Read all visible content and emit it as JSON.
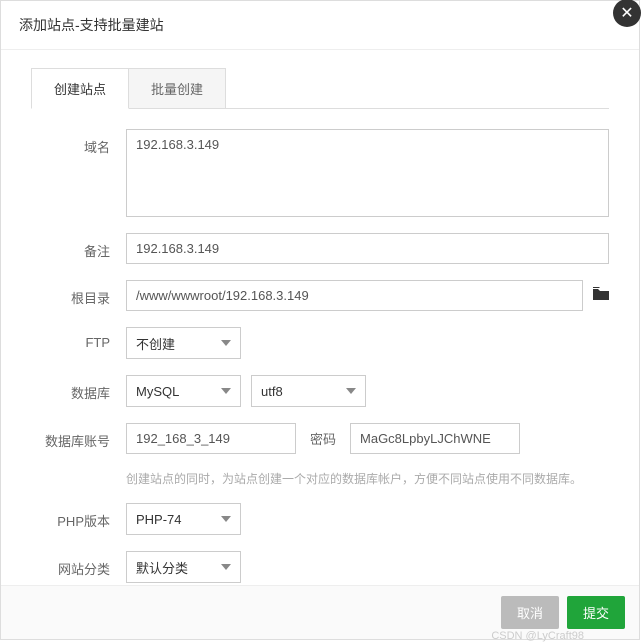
{
  "header": {
    "title": "添加站点-支持批量建站"
  },
  "tabs": {
    "create": "创建站点",
    "batch": "批量创建"
  },
  "labels": {
    "domain": "域名",
    "remark": "备注",
    "root": "根目录",
    "ftp": "FTP",
    "database": "数据库",
    "db_account": "数据库账号",
    "password": "密码",
    "php_version": "PHP版本",
    "category": "网站分类"
  },
  "values": {
    "domain": "192.168.3.149",
    "remark": "192.168.3.149",
    "root": "/www/wwwroot/192.168.3.149",
    "ftp": "不创建",
    "db_type": "MySQL",
    "db_charset": "utf8",
    "db_account": "192_168_3_149",
    "db_password": "MaGc8LpbyLJChWNE",
    "php_version": "PHP-74",
    "category": "默认分类"
  },
  "help": {
    "db": "创建站点的同时，为站点创建一个对应的数据库帐户，方便不同站点使用不同数据库。"
  },
  "buttons": {
    "cancel": "取消",
    "submit": "提交"
  },
  "watermark": "CSDN @LyCraft98"
}
